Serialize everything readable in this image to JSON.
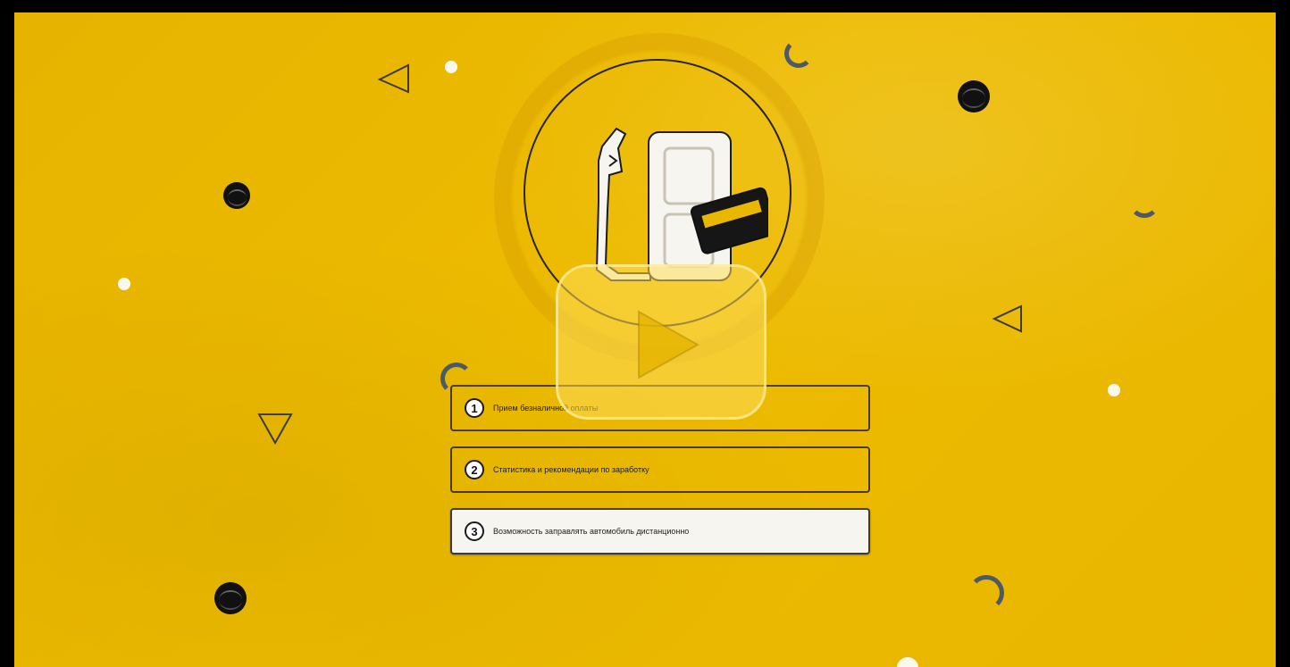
{
  "player": {
    "play_label": "Play"
  },
  "features": [
    {
      "number": "1",
      "text": "Прием безналичной оплаты"
    },
    {
      "number": "2",
      "text": "Статистика и рекомендации по заработку"
    },
    {
      "number": "3",
      "text": "Возможность заправлять автомобиль дистанционно"
    }
  ],
  "colors": {
    "background": "#ecb800",
    "frame": "#000000",
    "card": "#fdc700",
    "dark": "#1a1a1a"
  },
  "icons": {
    "hero": "fuel-pump-card-icon",
    "play": "play-icon"
  }
}
